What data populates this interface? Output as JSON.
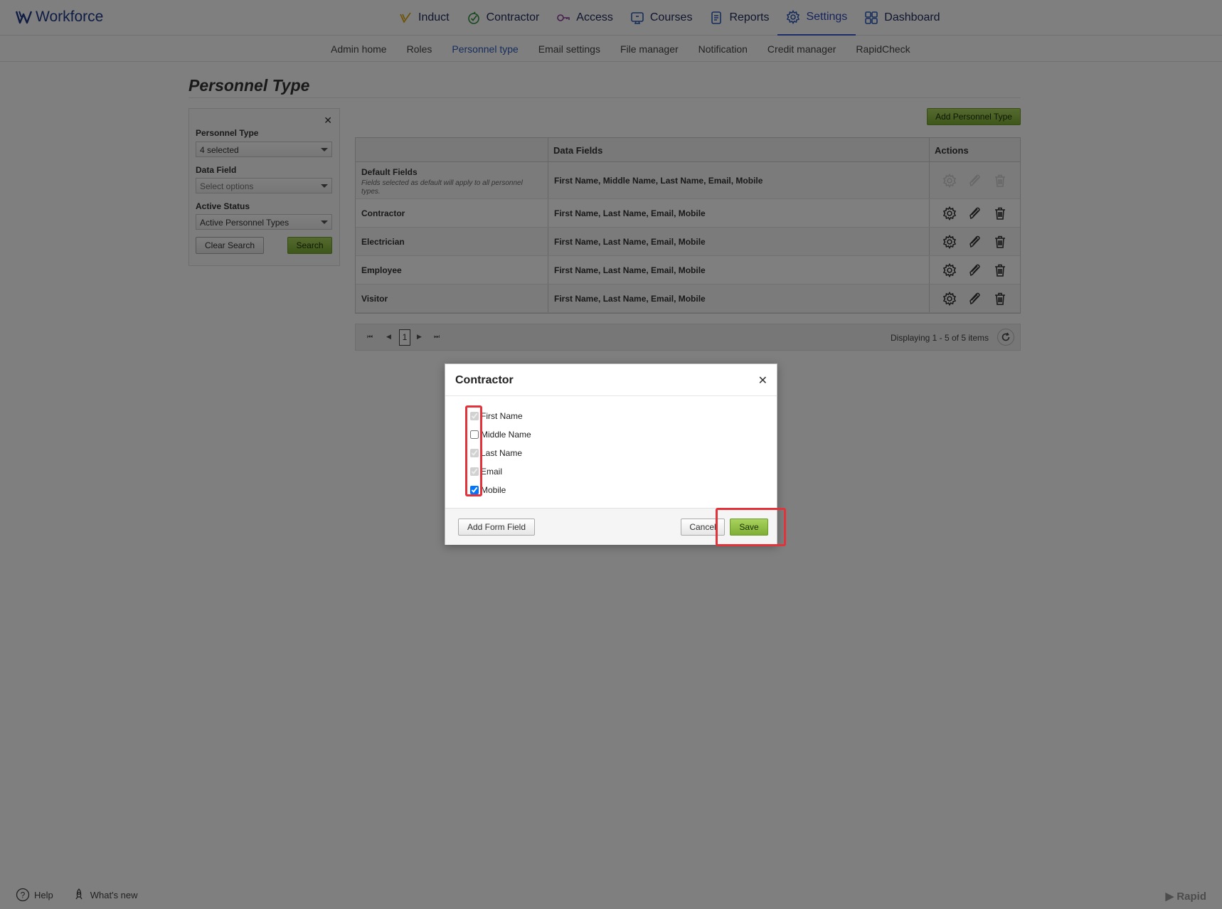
{
  "app": {
    "logo": "Workforce"
  },
  "topnav": [
    {
      "label": "Induct",
      "icon": "induct-icon",
      "color": "#d9a300"
    },
    {
      "label": "Contractor",
      "icon": "contractor-icon",
      "color": "#2f8f3a"
    },
    {
      "label": "Access",
      "icon": "access-icon",
      "color": "#8b3a9b"
    },
    {
      "label": "Courses",
      "icon": "courses-icon",
      "color": "#2d5bb8"
    },
    {
      "label": "Reports",
      "icon": "reports-icon",
      "color": "#2d5bb8"
    },
    {
      "label": "Settings",
      "icon": "settings-icon",
      "color": "#2d5bb8",
      "active": true
    },
    {
      "label": "Dashboard",
      "icon": "dashboard-icon",
      "color": "#2d5bb8"
    }
  ],
  "subnav": [
    "Admin home",
    "Roles",
    "Personnel type",
    "Email settings",
    "File manager",
    "Notification",
    "Credit manager",
    "RapidCheck"
  ],
  "subnav_active": "Personnel type",
  "page": {
    "title": "Personnel Type"
  },
  "filter": {
    "personnel_type_label": "Personnel Type",
    "personnel_type_value": "4 selected",
    "data_field_label": "Data Field",
    "data_field_placeholder": "Select options",
    "active_status_label": "Active Status",
    "active_status_value": "Active Personnel Types",
    "clear_label": "Clear Search",
    "search_label": "Search"
  },
  "add_button": "Add Personnel Type",
  "grid": {
    "columns": [
      "",
      "Data Fields",
      "Actions"
    ],
    "rows": [
      {
        "name": "Default Fields",
        "note": "Fields selected as default will apply to all personnel types.",
        "fields": "First Name, Middle Name, Last Name, Email, Mobile",
        "disabled_actions": true
      },
      {
        "name": "Contractor",
        "fields": "First Name, Last Name, Email, Mobile"
      },
      {
        "name": "Electrician",
        "fields": "First Name, Last Name, Email, Mobile"
      },
      {
        "name": "Employee",
        "fields": "First Name, Last Name, Email, Mobile"
      },
      {
        "name": "Visitor",
        "fields": "First Name, Last Name, Email, Mobile"
      }
    ]
  },
  "pager": {
    "page": "1",
    "display_text": "Displaying 1 - 5 of 5 items"
  },
  "footer": {
    "help": "Help",
    "whats_new": "What's new",
    "brand": "Rapid"
  },
  "modal": {
    "title": "Contractor",
    "fields": [
      {
        "label": "First Name",
        "checked": true,
        "disabled": true
      },
      {
        "label": "Middle Name",
        "checked": false,
        "disabled": false
      },
      {
        "label": "Last Name",
        "checked": true,
        "disabled": true
      },
      {
        "label": "Email",
        "checked": true,
        "disabled": true
      },
      {
        "label": "Mobile",
        "checked": true,
        "disabled": false
      }
    ],
    "add_field_label": "Add Form Field",
    "cancel_label": "Cancel",
    "save_label": "Save"
  }
}
